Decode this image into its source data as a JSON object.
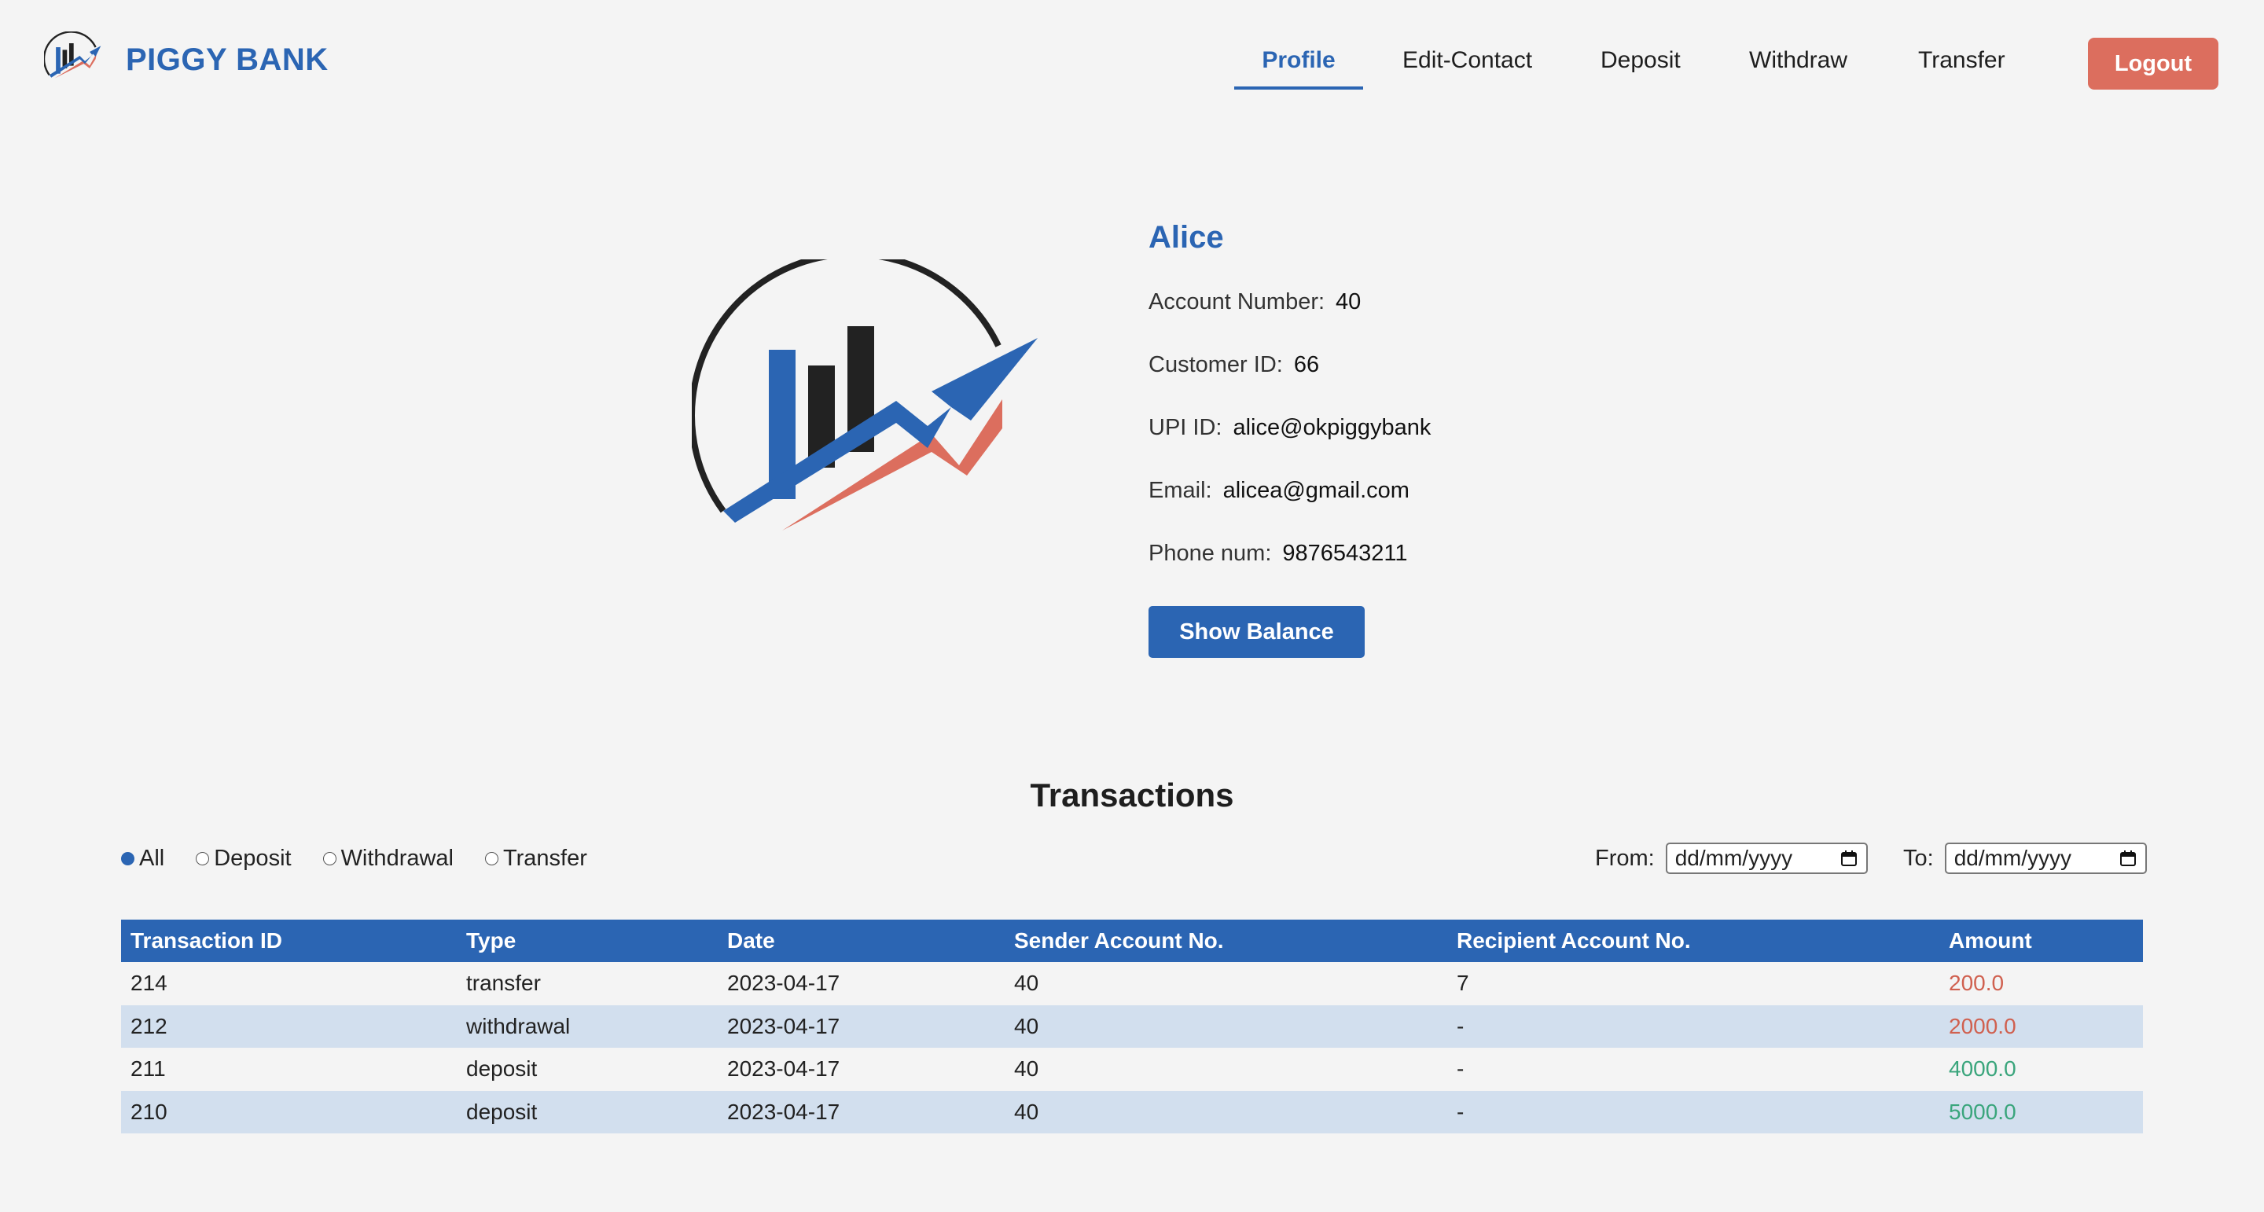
{
  "brand": {
    "name": "PIGGY BANK"
  },
  "nav": {
    "items": [
      {
        "label": "Profile",
        "active": true
      },
      {
        "label": "Edit-Contact",
        "active": false
      },
      {
        "label": "Deposit",
        "active": false
      },
      {
        "label": "Withdraw",
        "active": false
      },
      {
        "label": "Transfer",
        "active": false
      }
    ],
    "logout_label": "Logout"
  },
  "profile": {
    "name": "Alice",
    "fields": [
      {
        "label": "Account Number:",
        "value": "40"
      },
      {
        "label": "Customer ID:",
        "value": "66"
      },
      {
        "label": "UPI ID:",
        "value": "alice@okpiggybank"
      },
      {
        "label": "Email:",
        "value": "alicea@gmail.com"
      },
      {
        "label": "Phone num:",
        "value": "9876543211"
      }
    ],
    "show_balance_label": "Show Balance"
  },
  "transactions": {
    "title": "Transactions",
    "filters": [
      {
        "label": "All",
        "checked": true
      },
      {
        "label": "Deposit",
        "checked": false
      },
      {
        "label": "Withdrawal",
        "checked": false
      },
      {
        "label": "Transfer",
        "checked": false
      }
    ],
    "from_label": "From:",
    "to_label": "To:",
    "date_placeholder": "dd/mm/yyyy",
    "columns": [
      "Transaction ID",
      "Type",
      "Date",
      "Sender Account No.",
      "Recipient Account No.",
      "Amount"
    ],
    "rows": [
      [
        "214",
        "transfer",
        "2023-04-17",
        "40",
        "7",
        "200.0"
      ],
      [
        "212",
        "withdrawal",
        "2023-04-17",
        "40",
        "-",
        "2000.0"
      ],
      [
        "211",
        "deposit",
        "2023-04-17",
        "40",
        "-",
        "4000.0"
      ],
      [
        "210",
        "deposit",
        "2023-04-17",
        "40",
        "-",
        "5000.0"
      ]
    ]
  },
  "colors": {
    "brand_blue": "#2b65b3",
    "accent_red": "#dc6e5e",
    "debit_red": "#d0604f",
    "credit_green": "#3aa57c",
    "row_alt": "#d2dfee",
    "background": "#f4f4f4"
  },
  "icons": {
    "brand_logo": "piggy-bank-growth-logo",
    "calendar": "calendar-icon"
  }
}
